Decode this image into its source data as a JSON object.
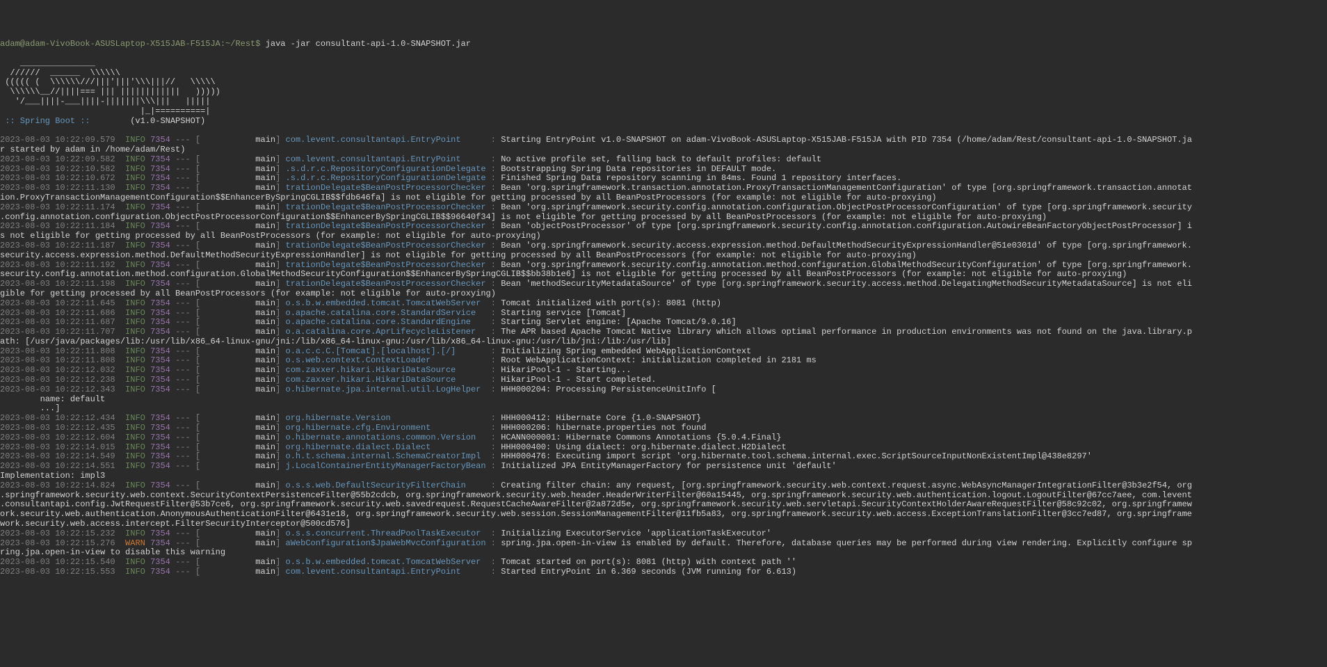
{
  "prompt": "adam@adam-VivoBook-ASUSLaptop-X515JAB-F515JA:~/Rest$",
  "command": "java -jar consultant-api-1.0-SNAPSHOT.jar",
  "ascii": [
    "    _______________",
    "  //////  ______  \\\\\\\\\\\\",
    " ((((( (  \\\\\\\\\\\\///|||'|||'\\\\\\|||//   \\\\\\\\\\",
    "  \\\\\\\\\\\\__//||||=== ||| ||||||||||||   )))))",
    "   '/___||||-___||||-|||||||\\\\\\|||   |||||",
    "                            |_|==========|"
  ],
  "springboot_label": " :: Spring Boot ::",
  "springboot_version": "        (v1.0-SNAPSHOT)",
  "logs": [
    {
      "ts": "2023-08-03 10:22:09.579",
      "lvl": "INFO",
      "pid": "7354",
      "thr": "main",
      "logger": "com.levent.consultantapi.EntryPoint",
      "msg": "Starting EntryPoint v1.0-SNAPSHOT on adam-VivoBook-ASUSLaptop-X515JAB-F515JA with PID 7354 (/home/adam/Rest/consultant-api-1.0-SNAPSHOT.ja"
    },
    {
      "cont": "r started by adam in /home/adam/Rest)"
    },
    {
      "ts": "2023-08-03 10:22:09.582",
      "lvl": "INFO",
      "pid": "7354",
      "thr": "main",
      "logger": "com.levent.consultantapi.EntryPoint",
      "msg": "No active profile set, falling back to default profiles: default"
    },
    {
      "ts": "2023-08-03 10:22:10.582",
      "lvl": "INFO",
      "pid": "7354",
      "thr": "main",
      "logger": ".s.d.r.c.RepositoryConfigurationDelegate",
      "msg": "Bootstrapping Spring Data repositories in DEFAULT mode."
    },
    {
      "ts": "2023-08-03 10:22:10.672",
      "lvl": "INFO",
      "pid": "7354",
      "thr": "main",
      "logger": ".s.d.r.c.RepositoryConfigurationDelegate",
      "msg": "Finished Spring Data repository scanning in 84ms. Found 1 repository interfaces."
    },
    {
      "ts": "2023-08-03 10:22:11.130",
      "lvl": "INFO",
      "pid": "7354",
      "thr": "main",
      "logger": "trationDelegate$BeanPostProcessorChecker",
      "msg": "Bean 'org.springframework.transaction.annotation.ProxyTransactionManagementConfiguration' of type [org.springframework.transaction.annotat"
    },
    {
      "cont": "ion.ProxyTransactionManagementConfiguration$$EnhancerBySpringCGLIB$$fdb646fa] is not eligible for getting processed by all BeanPostProcessors (for example: not eligible for auto-proxying)"
    },
    {
      "ts": "2023-08-03 10:22:11.174",
      "lvl": "INFO",
      "pid": "7354",
      "thr": "main",
      "logger": "trationDelegate$BeanPostProcessorChecker",
      "msg": "Bean 'org.springframework.security.config.annotation.configuration.ObjectPostProcessorConfiguration' of type [org.springframework.security"
    },
    {
      "cont": ".config.annotation.configuration.ObjectPostProcessorConfiguration$$EnhancerBySpringCGLIB$$96640f34] is not eligible for getting processed by all BeanPostProcessors (for example: not eligible for auto-proxying)"
    },
    {
      "ts": "2023-08-03 10:22:11.184",
      "lvl": "INFO",
      "pid": "7354",
      "thr": "main",
      "logger": "trationDelegate$BeanPostProcessorChecker",
      "msg": "Bean 'objectPostProcessor' of type [org.springframework.security.config.annotation.configuration.AutowireBeanFactoryObjectPostProcessor] i"
    },
    {
      "cont": "s not eligible for getting processed by all BeanPostProcessors (for example: not eligible for auto-proxying)"
    },
    {
      "ts": "2023-08-03 10:22:11.187",
      "lvl": "INFO",
      "pid": "7354",
      "thr": "main",
      "logger": "trationDelegate$BeanPostProcessorChecker",
      "msg": "Bean 'org.springframework.security.access.expression.method.DefaultMethodSecurityExpressionHandler@51e0301d' of type [org.springframework."
    },
    {
      "cont": "security.access.expression.method.DefaultMethodSecurityExpressionHandler] is not eligible for getting processed by all BeanPostProcessors (for example: not eligible for auto-proxying)"
    },
    {
      "ts": "2023-08-03 10:22:11.192",
      "lvl": "INFO",
      "pid": "7354",
      "thr": "main",
      "logger": "trationDelegate$BeanPostProcessorChecker",
      "msg": "Bean 'org.springframework.security.config.annotation.method.configuration.GlobalMethodSecurityConfiguration' of type [org.springframework."
    },
    {
      "cont": "security.config.annotation.method.configuration.GlobalMethodSecurityConfiguration$$EnhancerBySpringCGLIB$$bb38b1e6] is not eligible for getting processed by all BeanPostProcessors (for example: not eligible for auto-proxying)"
    },
    {
      "ts": "2023-08-03 10:22:11.198",
      "lvl": "INFO",
      "pid": "7354",
      "thr": "main",
      "logger": "trationDelegate$BeanPostProcessorChecker",
      "msg": "Bean 'methodSecurityMetadataSource' of type [org.springframework.security.access.method.DelegatingMethodSecurityMetadataSource] is not eli"
    },
    {
      "cont": "gible for getting processed by all BeanPostProcessors (for example: not eligible for auto-proxying)"
    },
    {
      "ts": "2023-08-03 10:22:11.645",
      "lvl": "INFO",
      "pid": "7354",
      "thr": "main",
      "logger": "o.s.b.w.embedded.tomcat.TomcatWebServer",
      "msg": "Tomcat initialized with port(s): 8081 (http)"
    },
    {
      "ts": "2023-08-03 10:22:11.686",
      "lvl": "INFO",
      "pid": "7354",
      "thr": "main",
      "logger": "o.apache.catalina.core.StandardService",
      "msg": "Starting service [Tomcat]"
    },
    {
      "ts": "2023-08-03 10:22:11.687",
      "lvl": "INFO",
      "pid": "7354",
      "thr": "main",
      "logger": "o.apache.catalina.core.StandardEngine",
      "msg": "Starting Servlet engine: [Apache Tomcat/9.0.16]"
    },
    {
      "ts": "2023-08-03 10:22:11.707",
      "lvl": "INFO",
      "pid": "7354",
      "thr": "main",
      "logger": "o.a.catalina.core.AprLifecycleListener",
      "msg": "The APR based Apache Tomcat Native library which allows optimal performance in production environments was not found on the java.library.p"
    },
    {
      "cont": "ath: [/usr/java/packages/lib:/usr/lib/x86_64-linux-gnu/jni:/lib/x86_64-linux-gnu:/usr/lib/x86_64-linux-gnu:/usr/lib/jni:/lib:/usr/lib]"
    },
    {
      "ts": "2023-08-03 10:22:11.808",
      "lvl": "INFO",
      "pid": "7354",
      "thr": "main",
      "logger": "o.a.c.c.C.[Tomcat].[localhost].[/]",
      "msg": "Initializing Spring embedded WebApplicationContext"
    },
    {
      "ts": "2023-08-03 10:22:11.808",
      "lvl": "INFO",
      "pid": "7354",
      "thr": "main",
      "logger": "o.s.web.context.ContextLoader",
      "msg": "Root WebApplicationContext: initialization completed in 2181 ms"
    },
    {
      "ts": "2023-08-03 10:22:12.032",
      "lvl": "INFO",
      "pid": "7354",
      "thr": "main",
      "logger": "com.zaxxer.hikari.HikariDataSource",
      "msg": "HikariPool-1 - Starting..."
    },
    {
      "ts": "2023-08-03 10:22:12.238",
      "lvl": "INFO",
      "pid": "7354",
      "thr": "main",
      "logger": "com.zaxxer.hikari.HikariDataSource",
      "msg": "HikariPool-1 - Start completed."
    },
    {
      "ts": "2023-08-03 10:22:12.343",
      "lvl": "INFO",
      "pid": "7354",
      "thr": "main",
      "logger": "o.hibernate.jpa.internal.util.LogHelper",
      "msg": "HHH000204: Processing PersistenceUnitInfo ["
    },
    {
      "cont": "        name: default"
    },
    {
      "cont": "        ...]"
    },
    {
      "ts": "2023-08-03 10:22:12.434",
      "lvl": "INFO",
      "pid": "7354",
      "thr": "main",
      "logger": "org.hibernate.Version",
      "msg": "HHH000412: Hibernate Core {1.0-SNAPSHOT}"
    },
    {
      "ts": "2023-08-03 10:22:12.435",
      "lvl": "INFO",
      "pid": "7354",
      "thr": "main",
      "logger": "org.hibernate.cfg.Environment",
      "msg": "HHH000206: hibernate.properties not found"
    },
    {
      "ts": "2023-08-03 10:22:12.604",
      "lvl": "INFO",
      "pid": "7354",
      "thr": "main",
      "logger": "o.hibernate.annotations.common.Version",
      "msg": "HCANN000001: Hibernate Commons Annotations {5.0.4.Final}"
    },
    {
      "ts": "2023-08-03 10:22:14.015",
      "lvl": "INFO",
      "pid": "7354",
      "thr": "main",
      "logger": "org.hibernate.dialect.Dialect",
      "msg": "HHH000400: Using dialect: org.hibernate.dialect.H2Dialect"
    },
    {
      "ts": "2023-08-03 10:22:14.549",
      "lvl": "INFO",
      "pid": "7354",
      "thr": "main",
      "logger": "o.h.t.schema.internal.SchemaCreatorImpl",
      "msg": "HHH000476: Executing import script 'org.hibernate.tool.schema.internal.exec.ScriptSourceInputNonExistentImpl@438e8297'"
    },
    {
      "ts": "2023-08-03 10:22:14.551",
      "lvl": "INFO",
      "pid": "7354",
      "thr": "main",
      "logger": "j.LocalContainerEntityManagerFactoryBean",
      "msg": "Initialized JPA EntityManagerFactory for persistence unit 'default'"
    },
    {
      "cont": "Implementation: impl3"
    },
    {
      "ts": "2023-08-03 10:22:14.824",
      "lvl": "INFO",
      "pid": "7354",
      "thr": "main",
      "logger": "o.s.s.web.DefaultSecurityFilterChain",
      "msg": "Creating filter chain: any request, [org.springframework.security.web.context.request.async.WebAsyncManagerIntegrationFilter@3b3e2f54, org"
    },
    {
      "cont": ".springframework.security.web.context.SecurityContextPersistenceFilter@55b2cdcb, org.springframework.security.web.header.HeaderWriterFilter@60a15445, org.springframework.security.web.authentication.logout.LogoutFilter@67cc7aee, com.levent"
    },
    {
      "cont": ".consultantapi.config.JwtRequestFilter@53b7ce6, org.springframework.security.web.savedrequest.RequestCacheAwareFilter@2a872d5e, org.springframework.security.web.servletapi.SecurityContextHolderAwareRequestFilter@58c92c02, org.springframew"
    },
    {
      "cont": "ork.security.web.authentication.AnonymousAuthenticationFilter@6431e18, org.springframework.security.web.session.SessionManagementFilter@11fb5a83, org.springframework.security.web.access.ExceptionTranslationFilter@3cc7ed87, org.springframe"
    },
    {
      "cont": "work.security.web.access.intercept.FilterSecurityInterceptor@500cd576]"
    },
    {
      "ts": "2023-08-03 10:22:15.232",
      "lvl": "INFO",
      "pid": "7354",
      "thr": "main",
      "logger": "o.s.s.concurrent.ThreadPoolTaskExecutor",
      "msg": "Initializing ExecutorService 'applicationTaskExecutor'"
    },
    {
      "ts": "2023-08-03 10:22:15.276",
      "lvl": "WARN",
      "pid": "7354",
      "thr": "main",
      "logger": "aWebConfiguration$JpaWebMvcConfiguration",
      "msg": "spring.jpa.open-in-view is enabled by default. Therefore, database queries may be performed during view rendering. Explicitly configure sp"
    },
    {
      "cont": "ring.jpa.open-in-view to disable this warning"
    },
    {
      "ts": "2023-08-03 10:22:15.540",
      "lvl": "INFO",
      "pid": "7354",
      "thr": "main",
      "logger": "o.s.b.w.embedded.tomcat.TomcatWebServer",
      "msg": "Tomcat started on port(s): 8081 (http) with context path ''"
    },
    {
      "ts": "2023-08-03 10:22:15.553",
      "lvl": "INFO",
      "pid": "7354",
      "thr": "main",
      "logger": "com.levent.consultantapi.EntryPoint",
      "msg": "Started EntryPoint in 6.369 seconds (JVM running for 6.613)"
    }
  ]
}
